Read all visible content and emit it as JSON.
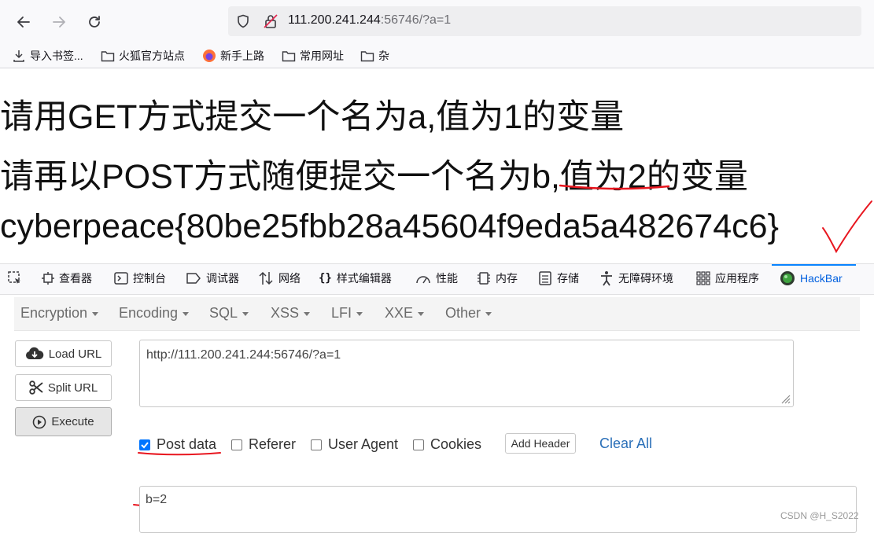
{
  "browser": {
    "url_host": "111.200.241.244",
    "url_rest": ":56746/?a=1",
    "bookmarks": [
      "导入书签...",
      "火狐官方站点",
      "新手上路",
      "常用网址",
      "杂"
    ]
  },
  "page": {
    "line1": "请用GET方式提交一个名为a,值为1的变量",
    "line2": "请再以POST方式随便提交一个名为b,值为2的变量",
    "flag": "cyberpeace{80be25fbb28a45604f9eda5a482674c6}"
  },
  "devtools": {
    "tabs": [
      "查看器",
      "控制台",
      "调试器",
      "网络",
      "样式编辑器",
      "性能",
      "内存",
      "存储",
      "无障碍环境",
      "应用程序",
      "HackBar"
    ]
  },
  "hackbar": {
    "menus": [
      "Encryption",
      "Encoding",
      "SQL",
      "XSS",
      "LFI",
      "XXE",
      "Other"
    ],
    "load_url": "Load URL",
    "split_url": "Split URL",
    "execute": "Execute",
    "url_value": "http://111.200.241.244:56746/?a=1",
    "options": {
      "post_data": "Post data",
      "referer": "Referer",
      "user_agent": "User Agent",
      "cookies": "Cookies",
      "post_data_checked": true
    },
    "add_header": "Add Header",
    "clear_all": "Clear All",
    "post_value": "b=2"
  },
  "watermark": "CSDN @H_S2022",
  "colors": {
    "annotation_red": "#e8161f",
    "accent_blue": "#0a84ff"
  }
}
